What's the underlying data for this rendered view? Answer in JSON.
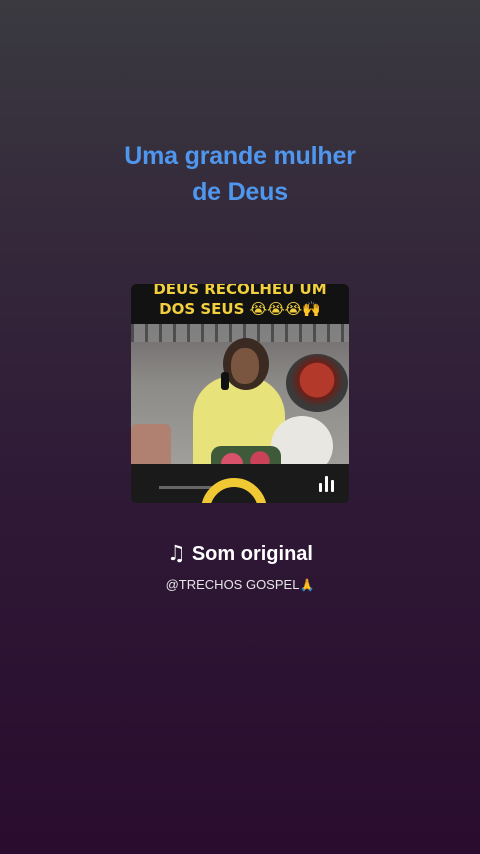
{
  "title": {
    "line1": "Uma grande mulher",
    "line2": "de Deus"
  },
  "video": {
    "caption_line1": "DEUS RECOLHEU UM",
    "caption_line2": "DOS SEUS 😭😭😭🙌",
    "playing_icon": "equalizer-icon"
  },
  "audio": {
    "note_icon": "♫",
    "label": "Som original",
    "author": "@TRECHOS GOSPEL",
    "author_emoji": "🙏"
  },
  "colors": {
    "title": "#4f97ee",
    "caption": "#f2cf3d",
    "background_top": "#3a3a40",
    "background_bottom": "#2a0c2e"
  }
}
